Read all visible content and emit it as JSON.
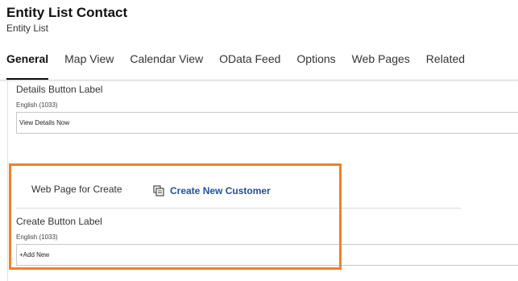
{
  "header": {
    "title": "Entity List Contact",
    "subtitle": "Entity List"
  },
  "tabs": [
    {
      "label": "General",
      "active": true
    },
    {
      "label": "Map View"
    },
    {
      "label": "Calendar View"
    },
    {
      "label": "OData Feed"
    },
    {
      "label": "Options"
    },
    {
      "label": "Web Pages"
    },
    {
      "label": "Related"
    }
  ],
  "details": {
    "label": "Details Button Label",
    "language": "English (1033)",
    "value": "View Details Now"
  },
  "web_page_create": {
    "label": "Web Page for Create",
    "link_text": "Create New Customer",
    "icon": "lookup-record-icon"
  },
  "create_button": {
    "label": "Create Button Label",
    "language": "English (1033)",
    "value": "+Add New"
  },
  "colors": {
    "highlight": "#f0802a",
    "link": "#1d4fa6"
  }
}
